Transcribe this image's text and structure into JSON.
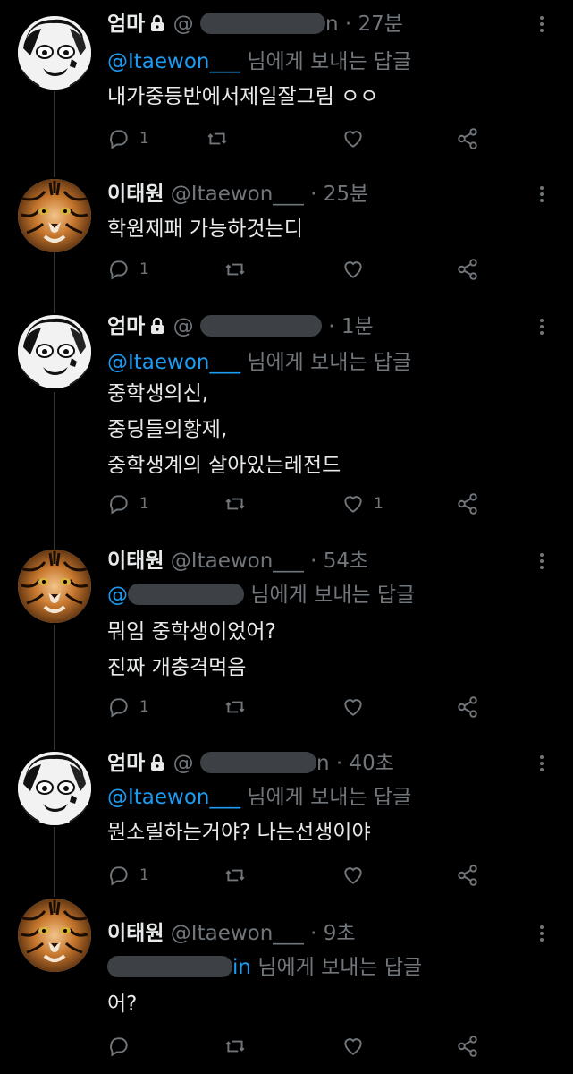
{
  "reply_label": "님에게 보내는 답글",
  "tweets": [
    {
      "author_name": "엄마",
      "locked": true,
      "handle_prefix": "@",
      "handle_suffix": "n",
      "dot": "·",
      "time": "27분",
      "reply_to": "@Itaewon___",
      "text": "내가중등반에서제일잘그림 ㅇㅇ",
      "reply_count": "1",
      "like_count": ""
    },
    {
      "author_name": "이태원",
      "locked": false,
      "handle": "@Itaewon___",
      "dot": "·",
      "time": "25분",
      "text": "학원제패 가능하것는디",
      "reply_count": "1",
      "like_count": ""
    },
    {
      "author_name": "엄마",
      "locked": true,
      "handle_prefix": "@",
      "dot": "·",
      "time": "1분",
      "reply_to": "@Itaewon___",
      "text": "중학생의신,\n중딩들의황제,\n중학생계의 살아있는레전드",
      "reply_count": "1",
      "like_count": "1"
    },
    {
      "author_name": "이태원",
      "locked": false,
      "handle": "@Itaewon___",
      "dot": "·",
      "time": "54초",
      "reply_to_prefix": "@",
      "text": "뭐임 중학생이었어?\n진짜 개충격먹음",
      "reply_count": "1",
      "like_count": ""
    },
    {
      "author_name": "엄마",
      "locked": true,
      "handle_prefix": "@",
      "handle_suffix": "n",
      "dot": "·",
      "time": "40초",
      "reply_to": "@Itaewon___",
      "text": "뭔소릴하는거야? 나는선생이야",
      "reply_count": "1",
      "like_count": ""
    },
    {
      "author_name": "이태원",
      "locked": false,
      "handle": "@Itaewon___",
      "dot": "·",
      "time": "9초",
      "reply_to_suffix": "in",
      "text": "어?",
      "reply_count": "",
      "like_count": ""
    }
  ],
  "icons": {
    "reply": "reply-icon",
    "retweet": "retweet-icon",
    "like": "heart-icon",
    "share": "share-icon",
    "lock": "lock-icon",
    "more": "more-icon"
  },
  "colors": {
    "background": "#000000",
    "text": "#e7e9ea",
    "secondary": "#71767b",
    "link": "#1d9bf0"
  }
}
